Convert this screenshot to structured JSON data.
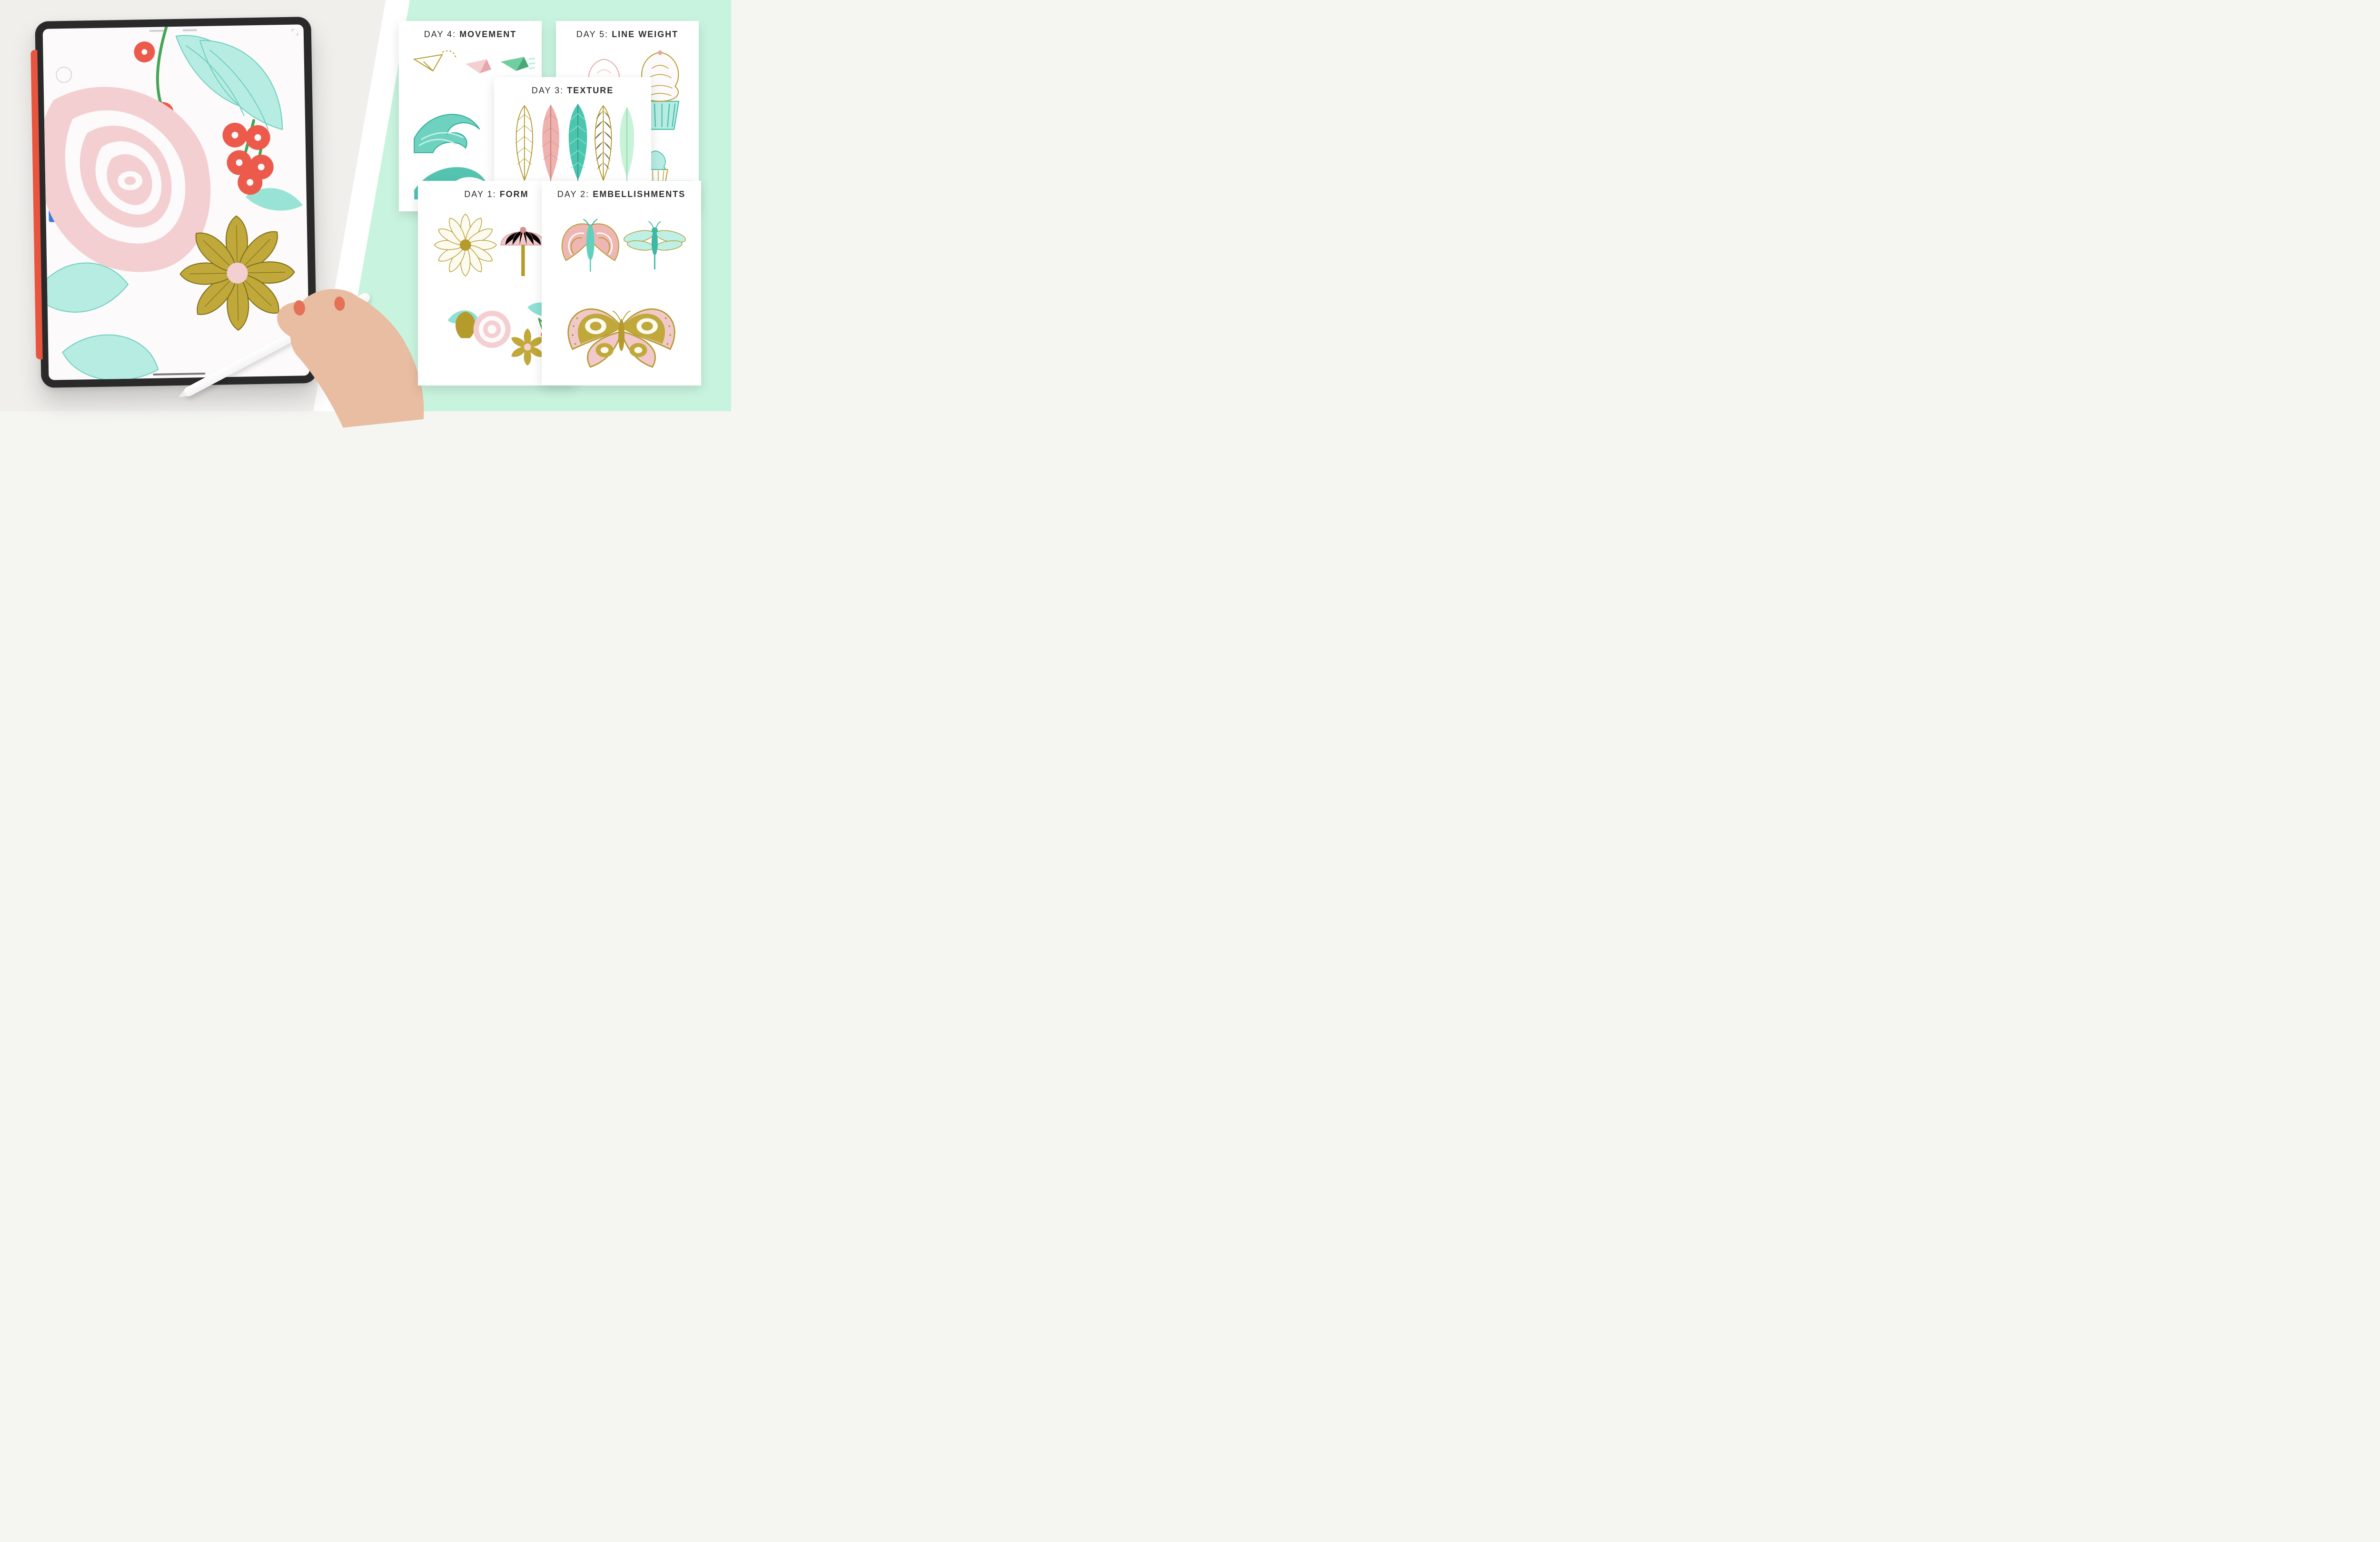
{
  "palette": {
    "mint_bg": "#c8f4df",
    "cream_bg": "#f0efec",
    "rose": "#f2c9cb",
    "rose_dk": "#e6a7ac",
    "olive": "#b59a2c",
    "olive_lt": "#cbb655",
    "teal": "#8fe0d5",
    "teal_dk": "#3db8a5",
    "coral": "#eb5a4a",
    "green_leaf": "#44a554",
    "ink": "#2d2d2d",
    "ipad_frame": "#2a2a2b",
    "ipad_case": "#e9543e",
    "accent_blue": "#3b79e0"
  },
  "tablet": {
    "device": "iPad Pro",
    "accessory": "Apple Pencil",
    "app_hint": "drawing app",
    "canvas_subject": "floral bouquet illustration"
  },
  "cards": {
    "day4": {
      "prefix": "DAY 4:",
      "keyword": "MOVEMENT"
    },
    "day5": {
      "prefix": "DAY 5:",
      "keyword": "LINE WEIGHT"
    },
    "day3": {
      "prefix": "DAY 3:",
      "keyword": "TEXTURE"
    },
    "day1": {
      "prefix": "DAY 1:",
      "keyword": "FORM"
    },
    "day2": {
      "prefix": "DAY 2:",
      "keyword": "EMBELLISHMENTS"
    }
  }
}
